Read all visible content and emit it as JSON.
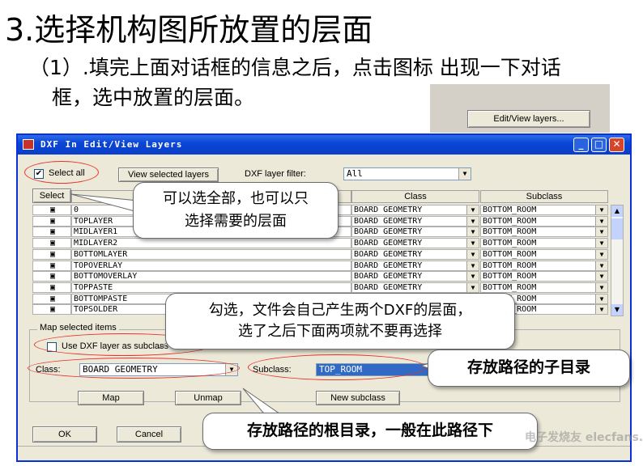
{
  "heading": "3.选择机构图所放置的层面",
  "step_line1": "（1）.填完上面对话框的信息之后，点击图标 出现一下对话",
  "step_line2": "框，选中放置的层面。",
  "edit_view_button": "Edit/View layers...",
  "dialog": {
    "title": "DXF In Edit/View Layers",
    "select_all_label": "Select all",
    "select_all_checked": true,
    "view_selected_button": "View selected layers",
    "filter_label": "DXF layer filter:",
    "filter_value": "All",
    "columns": [
      "Select",
      "DXF layer",
      "Class",
      "Subclass"
    ],
    "rows": [
      {
        "layer": "0",
        "class": "BOARD GEOMETRY",
        "subclass": "BOTTOM_ROOM"
      },
      {
        "layer": "TOPLAYER",
        "class": "BOARD GEOMETRY",
        "subclass": "BOTTOM_ROOM"
      },
      {
        "layer": "MIDLAYER1",
        "class": "BOARD GEOMETRY",
        "subclass": "BOTTOM_ROOM"
      },
      {
        "layer": "MIDLAYER2",
        "class": "BOARD GEOMETRY",
        "subclass": "BOTTOM_ROOM"
      },
      {
        "layer": "BOTTOMLAYER",
        "class": "BOARD GEOMETRY",
        "subclass": "BOTTOM_ROOM"
      },
      {
        "layer": "TOPOVERLAY",
        "class": "BOARD GEOMETRY",
        "subclass": "BOTTOM_ROOM"
      },
      {
        "layer": "BOTTOMOVERLAY",
        "class": "BOARD GEOMETRY",
        "subclass": "BOTTOM_ROOM"
      },
      {
        "layer": "TOPPASTE",
        "class": "BOARD GEOMETRY",
        "subclass": "BOTTOM_ROOM"
      },
      {
        "layer": "BOTTOMPASTE",
        "class": "BOARD GEOMETRY",
        "subclass": "BOTTOM_ROOM"
      },
      {
        "layer": "TOPSOLDER",
        "class": "BOARD GEOMETRY",
        "subclass": "BOTTOM_ROOM"
      }
    ],
    "map_group_label": "Map selected items",
    "use_dxf_label": "Use DXF layer as subclass",
    "class_label": "Class:",
    "class_value": "BOARD GEOMETRY",
    "subclass_label": "Subclass:",
    "subclass_value": "TOP_ROOM",
    "map_button": "Map",
    "unmap_button": "Unmap",
    "new_subclass_button": "New subclass",
    "ok_button": "OK",
    "cancel_button": "Cancel"
  },
  "callouts": {
    "select_tip_l1": "可以选全部，也可以只",
    "select_tip_l2": "选择需要的层面",
    "dxf_tip_l1": "勾选，文件会自己产生两个DXF的层面，",
    "dxf_tip_l2": "选了之后下面两项就不要再选择",
    "subdir_tip": "存放路径的子目录",
    "rootdir_tip": "存放路径的根目录，一般在此路径下"
  },
  "watermark": "电子发烧友 elecfans.com",
  "colors": {
    "titlebar": "#0a46d5",
    "dialog_bg": "#ece9d8",
    "annotation_red": "#e8322a"
  }
}
